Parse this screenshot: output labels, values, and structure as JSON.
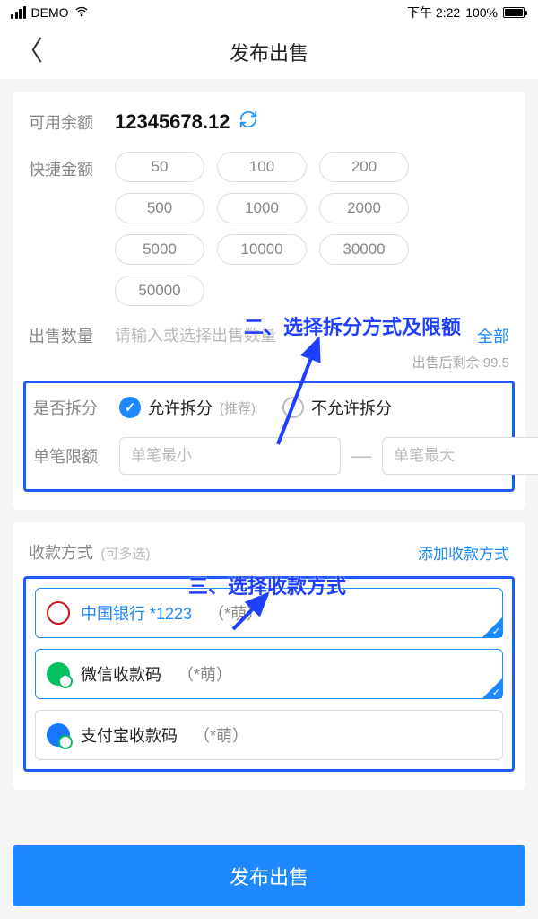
{
  "status": {
    "carrier": "DEMO",
    "time": "下午 2:22",
    "battery": "100%"
  },
  "nav": {
    "title": "发布出售"
  },
  "balance": {
    "label": "可用余额",
    "value": "12345678.12"
  },
  "quick": {
    "label": "快捷金额",
    "amounts": [
      "50",
      "100",
      "200",
      "500",
      "1000",
      "2000",
      "5000",
      "10000",
      "30000",
      "50000"
    ]
  },
  "qty": {
    "label": "出售数量",
    "placeholder": "请输入或选择出售数量",
    "allBtn": "全部",
    "after": "出售后剩余 99.5"
  },
  "split": {
    "label": "是否拆分",
    "allow": "允许拆分",
    "allowRec": "(推荐)",
    "disallow": "不允许拆分",
    "limitLabel": "单笔限额",
    "minPh": "单笔最小",
    "maxPh": "单笔最大"
  },
  "pay": {
    "label": "收款方式",
    "hint": "(可多选)",
    "add": "添加收款方式",
    "items": [
      {
        "iconClass": "bank",
        "main": "中国银行  *1223",
        "sub": "（*萌）",
        "selected": true,
        "mainColor": "bank-c"
      },
      {
        "iconClass": "wechat",
        "main": "微信收款码",
        "sub": "（*萌）",
        "selected": true,
        "mainColor": ""
      },
      {
        "iconClass": "alipay",
        "main": "支付宝收款码",
        "sub": "（*萌）",
        "selected": false,
        "mainColor": ""
      }
    ]
  },
  "submit": "发布出售",
  "annotations": {
    "step2": "二、选择拆分方式及限额",
    "step3": "三、选择收款方式"
  }
}
